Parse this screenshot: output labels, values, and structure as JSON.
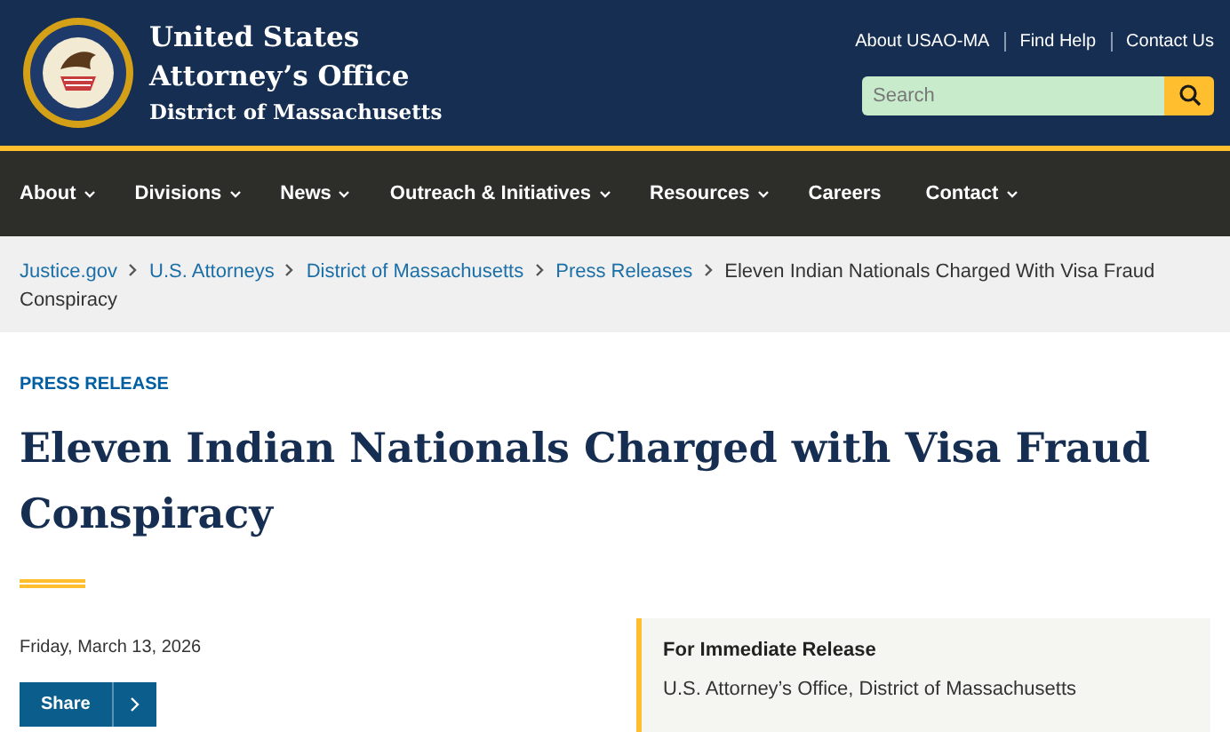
{
  "header": {
    "title_lines": [
      "United States",
      "Attorney’s Office"
    ],
    "subtitle": "District of Massachusetts",
    "utility_links": [
      "About USAO-MA",
      "Find Help",
      "Contact Us"
    ],
    "search": {
      "placeholder": "Search"
    }
  },
  "nav": [
    {
      "label": "About",
      "has_menu": true
    },
    {
      "label": "Divisions",
      "has_menu": true
    },
    {
      "label": "News",
      "has_menu": true
    },
    {
      "label": "Outreach & Initiatives",
      "has_menu": true
    },
    {
      "label": "Resources",
      "has_menu": true
    },
    {
      "label": "Careers",
      "has_menu": false
    },
    {
      "label": "Contact",
      "has_menu": true
    }
  ],
  "breadcrumb": [
    {
      "label": "Justice.gov",
      "link": true
    },
    {
      "label": "U.S. Attorneys",
      "link": true
    },
    {
      "label": "District of Massachusetts",
      "link": true
    },
    {
      "label": "Press Releases",
      "link": true
    },
    {
      "lines": [
        "Eleven Indian Nationals Charged With Visa Fraud",
        "Conspiracy"
      ],
      "link": false
    }
  ],
  "article": {
    "kicker": "PRESS RELEASE",
    "title": "Eleven Indian Nationals Charged with Visa Fraud Conspiracy",
    "date": "Friday, March 13, 2026",
    "share": "Share",
    "release_box": {
      "heading": "For Immediate Release",
      "office": "U.S. Attorney’s Office, District of Massachusetts"
    }
  }
}
